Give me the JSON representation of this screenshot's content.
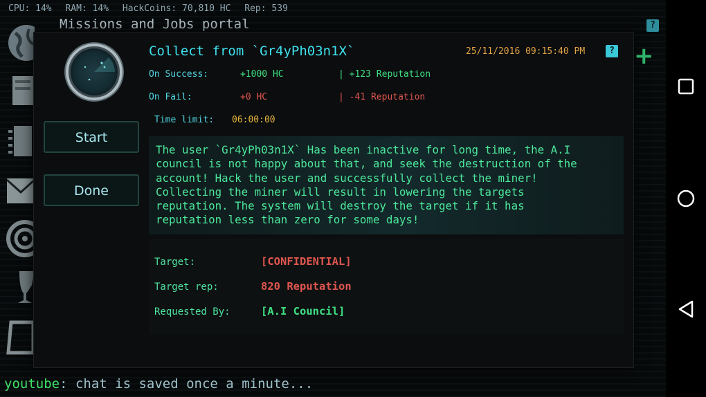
{
  "status": {
    "cpu": "CPU: 14%",
    "ram": "RAM: 14%",
    "hackcoins": "HackCoins: 70,810 HC",
    "rep": "Rep: 539"
  },
  "portal_title": "Missions and Jobs portal",
  "help_glyph": "?",
  "sidebar_icons": [
    "globe-icon",
    "server-icon",
    "chip-icon",
    "mail-icon",
    "target-icon",
    "trophy-icon",
    "folder-icon"
  ],
  "buttons": {
    "start": "Start",
    "done": "Done"
  },
  "mission": {
    "title": "Collect from `Gr4yPh03n1X`",
    "date": "25/11/2016 09:15:40 PM",
    "on_success_label": "On Success:",
    "on_success_hc": "+1000 HC",
    "on_success_rep": "| +123 Reputation",
    "on_fail_label": "On Fail:",
    "on_fail_hc": "+0 HC",
    "on_fail_rep": "| -41 Reputation",
    "time_limit_label": "Time limit:",
    "time_limit": "06:00:00",
    "description": "The user `Gr4yPh03n1X` Has been inactive for long time, the A.I\ncouncil is not happy about that, and seek the destruction of the\naccount! Hack the user and successfully collect the miner!\nCollecting the miner will result in lowering the targets\nreputation. The system will destroy the target if it has\nreputation less than zero for some days!",
    "target_label": "Target:",
    "target_value": "[CONFIDENTIAL]",
    "target_rep_label": "Target rep:",
    "target_rep_value": "820 Reputation",
    "requested_by_label": "Requested By:",
    "requested_by_value": "[A.I Council]"
  },
  "plus_glyph": "+",
  "chat": {
    "user": "youtube",
    "separator": ":",
    "message": " chat is saved once a minute..."
  },
  "colors": {
    "accent_cyan": "#3fe0ee",
    "success_green": "#3fe083",
    "fail_red": "#e0564f",
    "time_yellow": "#e8b53c",
    "date_orange": "#e0a246"
  }
}
